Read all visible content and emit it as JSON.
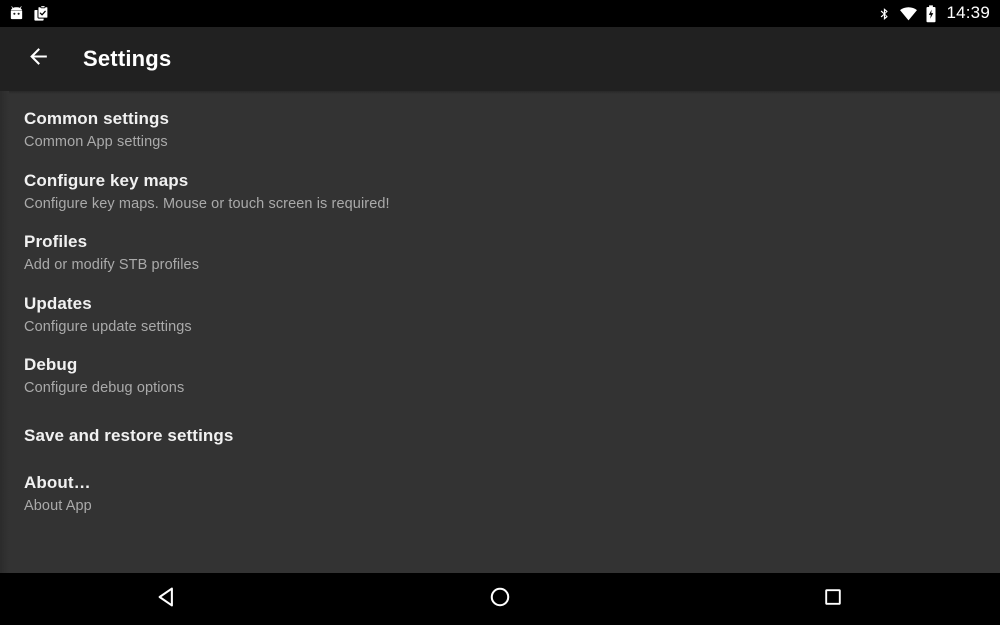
{
  "status_bar": {
    "notification_icons": [
      {
        "name": "android-robot-icon",
        "label": "Android app notification"
      },
      {
        "name": "clipboard-check-icon",
        "label": "Clipboard notification"
      }
    ],
    "system_icons": [
      {
        "name": "bluetooth-icon",
        "label": "Bluetooth"
      },
      {
        "name": "wifi-icon",
        "label": "Wi-Fi"
      },
      {
        "name": "battery-charging-icon",
        "label": "Battery charging"
      }
    ],
    "clock": "14:39"
  },
  "app_bar": {
    "back_icon": "arrow-back-icon",
    "title": "Settings"
  },
  "settings": {
    "items": [
      {
        "title": "Common settings",
        "subtitle": "Common App settings"
      },
      {
        "title": "Configure key maps",
        "subtitle": "Configure key maps. Mouse or touch screen is required!"
      },
      {
        "title": "Profiles",
        "subtitle": "Add or modify STB profiles"
      },
      {
        "title": "Updates",
        "subtitle": "Configure update settings"
      },
      {
        "title": "Debug",
        "subtitle": "Configure debug options"
      },
      {
        "title": "Save and restore settings",
        "subtitle": ""
      },
      {
        "title": "About…",
        "subtitle": "About App"
      }
    ]
  },
  "nav_bar": {
    "buttons": [
      {
        "name": "nav-back-button",
        "icon": "triangle-back-icon",
        "label": "Back"
      },
      {
        "name": "nav-home-button",
        "icon": "circle-home-icon",
        "label": "Home"
      },
      {
        "name": "nav-recents-button",
        "icon": "square-recents-icon",
        "label": "Recents"
      }
    ]
  },
  "colors": {
    "status_bar_bg": "#000000",
    "app_bar_bg": "#212121",
    "content_bg": "#333333",
    "nav_bar_bg": "#000000",
    "title_text": "#f1f1f1",
    "subtitle_text": "#aaaaaa"
  }
}
